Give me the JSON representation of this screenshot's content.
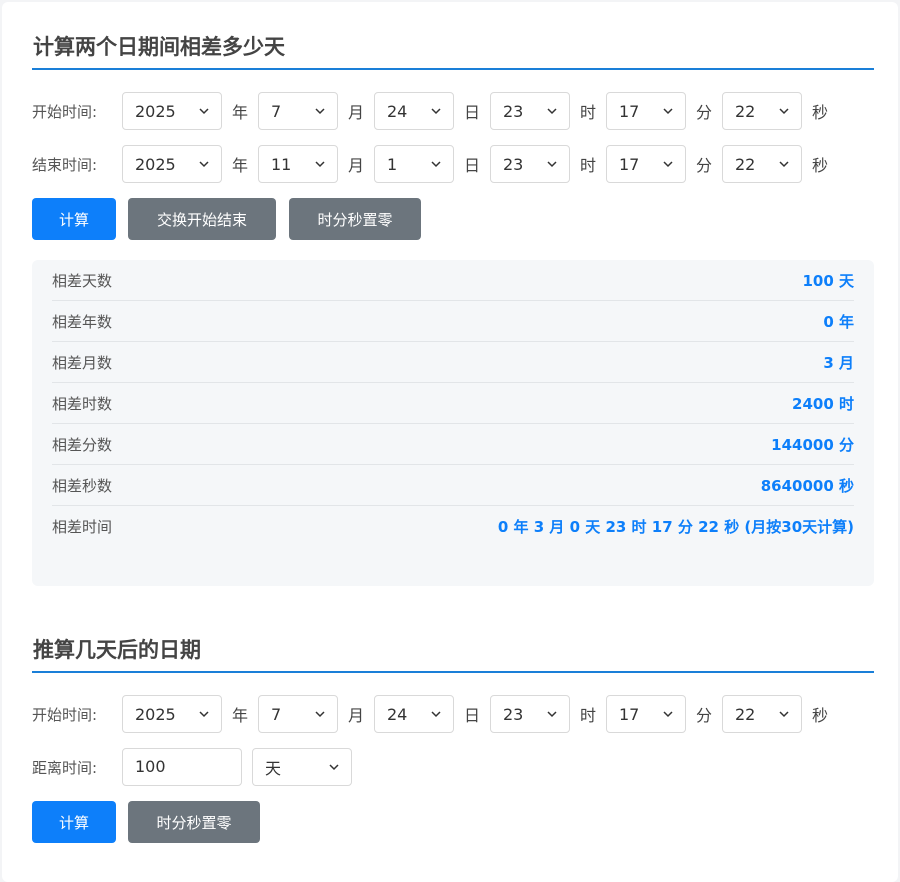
{
  "calc_diff": {
    "title": "计算两个日期间相差多少天",
    "start": {
      "label": "开始时间:",
      "year": "2025",
      "month": "7",
      "day": "24",
      "hour": "23",
      "minute": "17",
      "second": "22"
    },
    "end": {
      "label": "结束时间:",
      "year": "2025",
      "month": "11",
      "day": "1",
      "hour": "23",
      "minute": "17",
      "second": "22"
    },
    "units": {
      "year": "年",
      "month": "月",
      "day": "日",
      "hour": "时",
      "minute": "分",
      "second": "秒"
    },
    "buttons": {
      "calc": "计算",
      "swap": "交换开始结束",
      "reset": "时分秒置零"
    },
    "results": [
      {
        "label": "相差天数",
        "value": "100 天"
      },
      {
        "label": "相差年数",
        "value": "0 年"
      },
      {
        "label": "相差月数",
        "value": "3 月"
      },
      {
        "label": "相差时数",
        "value": "2400 时"
      },
      {
        "label": "相差分数",
        "value": "144000 分"
      },
      {
        "label": "相差秒数",
        "value": "8640000 秒"
      },
      {
        "label": "相差时间",
        "value": "0 年 3 月 0 天 23 时 17 分 22 秒 (月按30天计算)"
      }
    ]
  },
  "calc_after": {
    "title": "推算几天后的日期",
    "start": {
      "label": "开始时间:",
      "year": "2025",
      "month": "7",
      "day": "24",
      "hour": "23",
      "minute": "17",
      "second": "22"
    },
    "distance": {
      "label": "距离时间:",
      "value": "100",
      "unit": "天"
    },
    "buttons": {
      "calc": "计算",
      "reset": "时分秒置零"
    }
  },
  "colors": {
    "primary": "#0d7ffa",
    "gray_button": "#6c757d",
    "accent_line": "#1a7fd8"
  },
  "icons": {
    "dropdown": "chevron-down-icon"
  }
}
